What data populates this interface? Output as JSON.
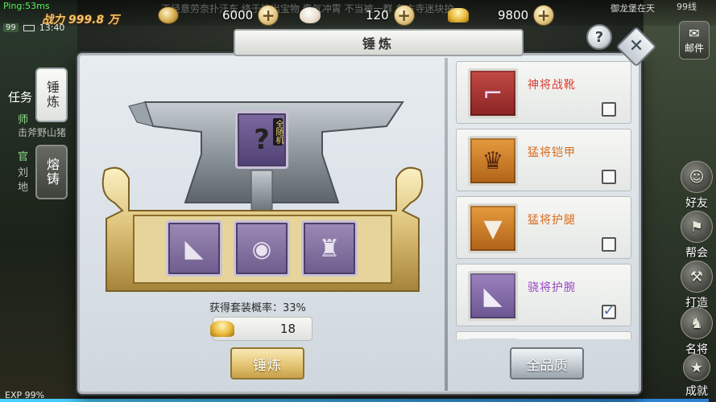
{
  "hud": {
    "ping": "Ping:53ms",
    "level": "99",
    "time": "13:40",
    "power": "战力 999.8 万",
    "ticker": "不经意劳奈扑汗东    终于挖出宝物    牵气冲霄    不当被一群    各方寺迷块护",
    "currencies": [
      {
        "icon": "copper-coin-icon",
        "amount": "6000"
      },
      {
        "icon": "steamed-bun-icon",
        "amount": "120"
      },
      {
        "icon": "gold-ingot-icon",
        "amount": "9800"
      }
    ],
    "server": "御龙堡在天",
    "lines": "99线",
    "exp": "EXP 99%",
    "exp_fraction": 0.99,
    "left_texts": [
      "任务",
      "师",
      "击斧野山猪",
      "官",
      "刘",
      "地"
    ]
  },
  "side_menu": [
    {
      "label": "邮件",
      "icon": "mail-icon"
    },
    {
      "label": "好友",
      "icon": "friends-icon"
    },
    {
      "label": "帮会",
      "icon": "guild-icon"
    },
    {
      "label": "打造",
      "icon": "hammer-icon"
    },
    {
      "label": "名将",
      "icon": "general-icon"
    },
    {
      "label": "成就",
      "icon": "achievement-icon"
    }
  ],
  "dialog": {
    "title": "锤炼",
    "help_label": "?",
    "close_label": "✕",
    "tabs": [
      {
        "label": "锤炼",
        "active": true
      },
      {
        "label": "熔铸",
        "active": false
      }
    ],
    "result_slot": {
      "glyph": "?",
      "caption": "全随机"
    },
    "rate_text": "获得套装概率：33%",
    "cost": "18",
    "forge_button": "锤炼",
    "all_quality_button": "全品质"
  },
  "equipment": [
    {
      "name": "神将战靴",
      "quality": "red",
      "icon": "boots-icon",
      "checked": false
    },
    {
      "name": "猛将铠甲",
      "quality": "orange",
      "icon": "armor-icon",
      "checked": false
    },
    {
      "name": "猛将护腿",
      "quality": "orange",
      "icon": "leg-guard-icon",
      "checked": false
    },
    {
      "name": "骁将护腕",
      "quality": "purple",
      "icon": "bracer-icon",
      "checked": true
    }
  ]
}
